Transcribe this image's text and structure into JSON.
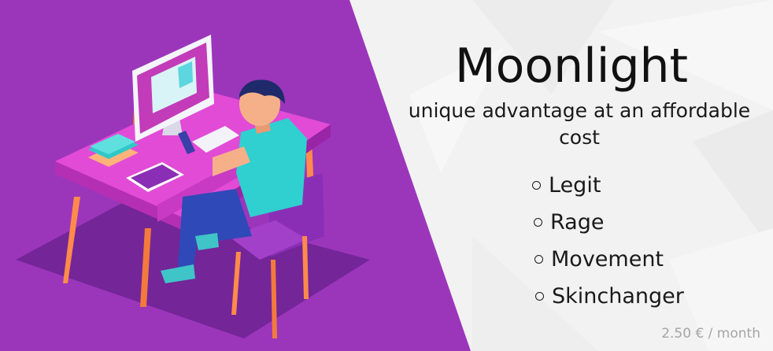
{
  "product": {
    "title": "Moonlight",
    "tagline": "unique advantage at an affordable cost",
    "features": [
      {
        "label": "Legit",
        "icon": "circle-bullet-icon"
      },
      {
        "label": "Rage",
        "icon": "circle-bullet-icon"
      },
      {
        "label": "Movement",
        "icon": "circle-bullet-icon"
      },
      {
        "label": "Skinchanger",
        "icon": "circle-bullet-icon"
      }
    ],
    "price": "2.50 € / month"
  },
  "colors": {
    "panel_purple": "#9b36bb",
    "background_light": "#f2f2f2",
    "desk_pink": "#e24bd6",
    "shirt_teal": "#2fd0cf",
    "chair_purple": "#8a2fb5",
    "legs_orange": "#ff8a4c",
    "price_gray": "#a5a5a5"
  }
}
